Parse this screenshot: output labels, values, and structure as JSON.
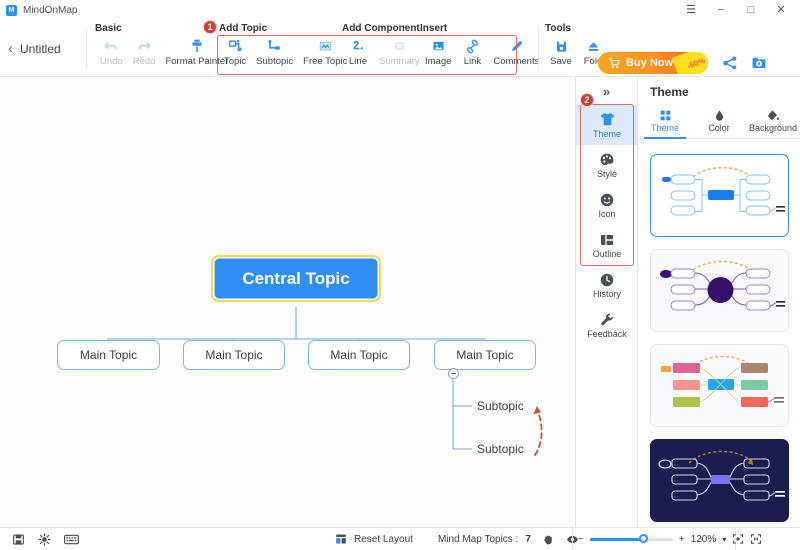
{
  "window": {
    "app_name": "MindOnMap",
    "logo_letter": "M",
    "controls": [
      {
        "name": "menu",
        "glyph": "☰"
      },
      {
        "name": "minimize",
        "glyph": "−"
      },
      {
        "name": "maximize",
        "glyph": "□"
      },
      {
        "name": "close",
        "glyph": "✕"
      }
    ]
  },
  "document": {
    "back_glyph": "‹",
    "name": "Untitled"
  },
  "ribbon": {
    "groups": [
      {
        "label": "Basic",
        "items": [
          {
            "label": "Undo",
            "icon": "undo-arrow-icon",
            "disabled": true
          },
          {
            "label": "Redo",
            "icon": "redo-arrow-icon",
            "disabled": true
          },
          {
            "label": "Format Painter",
            "icon": "format-painter-icon",
            "disabled": false
          }
        ]
      },
      {
        "label": "Add Topic",
        "items": [
          {
            "label": "Topic",
            "icon": "topic-icon",
            "disabled": false
          },
          {
            "label": "Subtopic",
            "icon": "subtopic-icon",
            "disabled": false
          },
          {
            "label": "Free Topic",
            "icon": "free-topic-icon",
            "disabled": false
          }
        ]
      },
      {
        "label": "Add Component",
        "items": [
          {
            "label": "Line",
            "icon": "line-icon",
            "disabled": false
          },
          {
            "label": "Summary",
            "icon": "summary-icon",
            "disabled": true
          }
        ]
      },
      {
        "label": "Insert",
        "items": [
          {
            "label": "Image",
            "icon": "image-icon",
            "disabled": false
          },
          {
            "label": "Link",
            "icon": "link-icon",
            "disabled": false
          },
          {
            "label": "Comments",
            "icon": "comments-pen-icon",
            "disabled": false
          }
        ]
      },
      {
        "label": "Tools",
        "items": [
          {
            "label": "Save",
            "icon": "save-disk-icon",
            "disabled": false
          },
          {
            "label": "Fold",
            "icon": "fold-eject-icon",
            "disabled": false
          }
        ]
      }
    ],
    "buy": {
      "label": "Buy Now",
      "discount": "-60%",
      "cart_icon": "shopping-cart-icon"
    },
    "top_actions": [
      {
        "name": "share-icon"
      },
      {
        "name": "cloud-upload-folder-icon"
      }
    ]
  },
  "annotations": [
    {
      "id": "1",
      "label": "1"
    },
    {
      "id": "2",
      "label": "2"
    }
  ],
  "mindmap": {
    "central": {
      "label": "Central Topic"
    },
    "main_topics": [
      {
        "label": "Main Topic"
      },
      {
        "label": "Main Topic"
      },
      {
        "label": "Main Topic"
      },
      {
        "label": "Main Topic"
      }
    ],
    "subtopics": [
      {
        "label": "Subtopic"
      },
      {
        "label": "Subtopic"
      }
    ],
    "collapse_glyph": "−"
  },
  "rail": {
    "expand_glyph": "»",
    "items": [
      {
        "label": "Theme",
        "icon": "tshirt-theme-icon",
        "active": true
      },
      {
        "label": "Style",
        "icon": "palette-style-icon",
        "active": false
      },
      {
        "label": "Icon",
        "icon": "smiley-icon",
        "active": false
      },
      {
        "label": "Outline",
        "icon": "outline-layout-icon",
        "active": false
      },
      {
        "label": "History",
        "icon": "clock-history-icon",
        "active": false
      },
      {
        "label": "Feedback",
        "icon": "wrench-feedback-icon",
        "active": false
      }
    ]
  },
  "panel": {
    "title": "Theme",
    "tabs": [
      {
        "label": "Theme",
        "icon": "grid-squares-icon",
        "active": true
      },
      {
        "label": "Color",
        "icon": "color-drop-icon",
        "active": false
      },
      {
        "label": "Background",
        "icon": "paint-bucket-icon",
        "active": false
      }
    ],
    "thumbnails": [
      {
        "name": "theme-blue-classic",
        "selected": true
      },
      {
        "name": "theme-purple-radial",
        "selected": false
      },
      {
        "name": "theme-colorful-blocks",
        "selected": false
      },
      {
        "name": "theme-dark-navy",
        "selected": false
      }
    ]
  },
  "statusbar": {
    "left_icons": [
      {
        "name": "save-state-icon"
      },
      {
        "name": "brightness-icon"
      },
      {
        "name": "keyboard-shortcuts-icon"
      }
    ],
    "reset_layout": {
      "label": "Reset Layout",
      "icon": "reset-layout-icon"
    },
    "topics_label": "Mind Map Topics :",
    "topics_count": "7",
    "hand_icon": "hand-pan-icon",
    "eye_icon": "eye-presentation-icon",
    "zoom": {
      "minus": "−",
      "plus": "+",
      "level": "120%",
      "caret": "▾",
      "fit_icon": "fit-center-icon",
      "fullscreen_icon": "fullscreen-icon"
    }
  },
  "colors": {
    "accent": "#2f8ff5",
    "central_fill": "#2f8ff5",
    "central_border": "#f5d94e",
    "node_border": "#7db6ec",
    "highlight": "#e06a64",
    "badge": "#d93a33",
    "buy_start": "#fba524",
    "buy_end": "#f4642c"
  }
}
